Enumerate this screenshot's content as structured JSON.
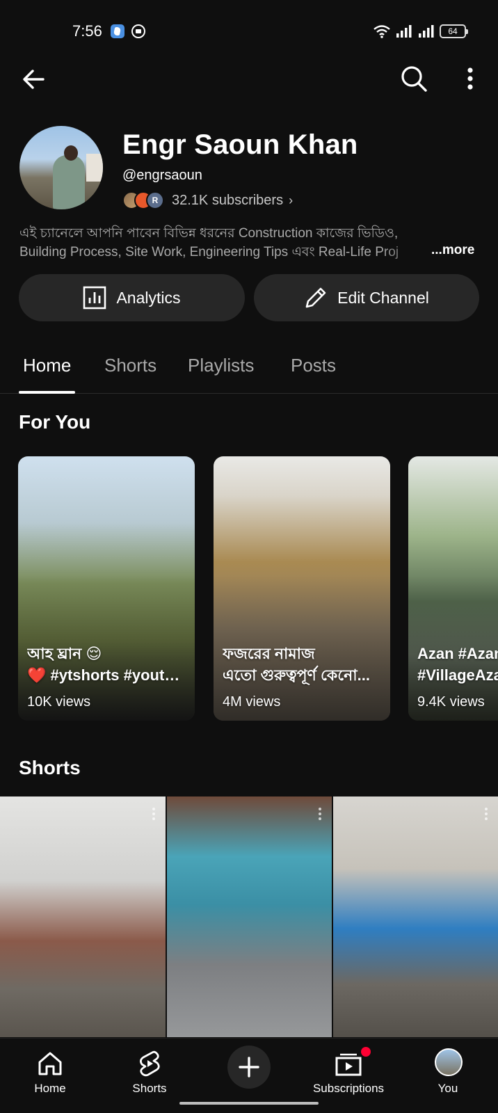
{
  "status_bar": {
    "time": "7:56",
    "battery": "64",
    "icons": [
      "app-notification-icon",
      "media-notification-icon",
      "wifi-icon",
      "signal-icon",
      "signal-icon",
      "battery-icon"
    ]
  },
  "top_bar": {
    "icons": [
      "back-arrow-icon",
      "search-icon",
      "more-vert-icon"
    ]
  },
  "channel": {
    "name": "Engr Saoun Khan",
    "handle": "@engrsaoun",
    "subscribers": "32.1K subscribers",
    "subscriber_avatar_initial": "R",
    "description_line1": "এই চ্যানেলে আপনি পাবেন বিভিন্ন ধরনের Construction কাজের ভিডিও,",
    "description_line2": "Building Process, Site Work, Engineering Tips এবং Real-Life Proj",
    "more_label": "...more"
  },
  "actions": {
    "analytics_label": "Analytics",
    "edit_label": "Edit Channel"
  },
  "tabs": [
    {
      "label": "Home",
      "active": true
    },
    {
      "label": "Shorts",
      "active": false
    },
    {
      "label": "Playlists",
      "active": false
    },
    {
      "label": "Posts",
      "active": false
    }
  ],
  "for_you": {
    "title": "For You",
    "items": [
      {
        "title_line1": "আহ ঘ্রান 😌",
        "title_line2": "❤️ #ytshorts #youtube",
        "views": "10K views"
      },
      {
        "title_line1": "ফজরের নামাজ",
        "title_line2": "এতো গুরুত্বপূর্ণ কেনো...",
        "views": "4M views"
      },
      {
        "title_line1": "Azan #Azan",
        "title_line2": "#VillageAzan",
        "views": "9.4K views"
      }
    ]
  },
  "shorts": {
    "title": "Shorts",
    "count": 3
  },
  "bottom_nav": {
    "home": "Home",
    "shorts": "Shorts",
    "subscriptions": "Subscriptions",
    "you": "You"
  },
  "colors": {
    "background": "#0f0f0f",
    "button_bg": "#272727",
    "notification_dot": "#ff0033",
    "secondary_text": "#aaaaaa"
  }
}
